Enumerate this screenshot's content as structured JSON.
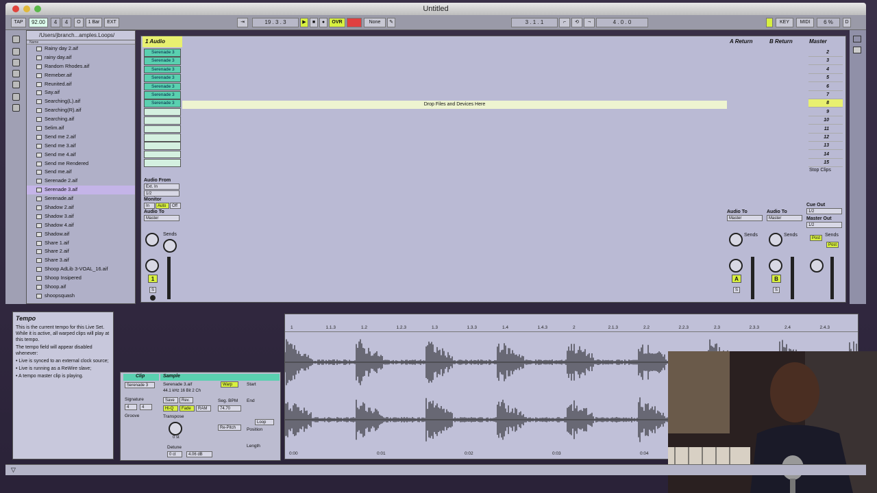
{
  "window": {
    "title": "Untitled"
  },
  "transport": {
    "tap": "TAP",
    "tempo": "92.00",
    "sig_num": "4",
    "sig_den": "4",
    "metro": "O",
    "quant": "1 Bar",
    "ext": "EXT",
    "position": "19 . 3 . 3",
    "ovr": "OVR",
    "key_none": "None",
    "loop_start": "3 . 1 . 1",
    "loop_len": "4 . 0 . 0",
    "key": "KEY",
    "midi": "MIDI",
    "cpu": "6 %"
  },
  "browser": {
    "path": "/Users/jbranch...amples.Loops/",
    "name_col": "Name",
    "items": [
      "Rainy day 2.aif",
      "rainy day.aif",
      "Random Rhodes.aif",
      "Remeber.aif",
      "Reunited.aif",
      "Say.aif",
      "Searching(L).aif",
      "Searching(R).aif",
      "Searching.aif",
      "Selim.aif",
      "Send me 2.aif",
      "Send me 3.aif",
      "Send me 4.aif",
      "Send me Rendered",
      "Send me.aif",
      "Serenade 2.aif",
      "Serenade 3.aif",
      "Serenade.aif",
      "Shadow 2.aif",
      "Shadow 3.aif",
      "Shadow 4.aif",
      "Shadow.aif",
      "Share 1.aif",
      "Share 2.aif",
      "Share 3.aif",
      "Shoop AdLib 3-VOAL_16.aif",
      "Shoop Insipered",
      "Shoop.aif",
      "shoopsquash"
    ],
    "selected_index": 16
  },
  "session": {
    "track1": "1 Audio",
    "return_a": "A Return",
    "return_b": "B Return",
    "master": "Master",
    "clip_name": "Serenade 3",
    "drop_text": "Drop Files and Devices Here",
    "scenes": [
      "2",
      "3",
      "4",
      "5",
      "6",
      "7",
      "8",
      "9",
      "10",
      "11",
      "12",
      "13",
      "14",
      "15"
    ],
    "stop_clips": "Stop Clips",
    "audio_from": "Audio From",
    "ext_in": "Ext. In",
    "ch12": "1/2",
    "monitor": "Monitor",
    "mon_in": "In",
    "mon_auto": "Auto",
    "mon_off": "Off",
    "audio_to": "Audio To",
    "master_out": "Master",
    "sends": "Sends",
    "track_num": "1",
    "solo": "S",
    "cue_out": "Cue Out",
    "master_out_label": "Master Out",
    "post": "Post",
    "ret_a_btn": "A",
    "ret_b_btn": "B"
  },
  "info": {
    "title": "Tempo",
    "body": "This is the current tempo for this Live Set. While it is active, all warped clips will play at this tempo.",
    "disabled": "The tempo field will appear disabled whenever:",
    "bullets": [
      "Live is synced to an external clock source;",
      "Live is running as a ReWire slave;",
      "A tempo master clip is playing."
    ]
  },
  "clip": {
    "clip_tab": "Clip",
    "sample_tab": "Sample",
    "clip_name": "Serenade 3",
    "sample_name": "Serenade 3.aif",
    "sample_info": "44.1 kHz 16 Bit 2 Ch",
    "warp": "Warp",
    "signature": "Signature",
    "sig_num": "4",
    "sig_den": "4",
    "groove": "Groove",
    "save": "Save",
    "rev": "Rev.",
    "hiq": "Hi-Q",
    "fade": "Fade",
    "ram": "RAM",
    "seg_bpm": "Seg. BPM",
    "bpm": "74.70",
    "transpose": "Transpose",
    "detune": "Detune",
    "st": "0 st",
    "ct": "0 ct",
    "db": "4.06 dB",
    "start": "Start",
    "end": "End",
    "loop": "Loop",
    "position": "Position",
    "length": "Length",
    "repitch": "Re-Pitch"
  },
  "waveform": {
    "ruler": [
      "1",
      "1.1.3",
      "1.2",
      "1.2.3",
      "1.3",
      "1.3.3",
      "1.4",
      "1.4.3",
      "2",
      "2.1.3",
      "2.2",
      "2.2.3",
      "2.3",
      "2.3.3",
      "2.4",
      "2.4.3"
    ],
    "time": [
      "0:00",
      "0:01",
      "0:02",
      "0:03",
      "0:04"
    ]
  }
}
